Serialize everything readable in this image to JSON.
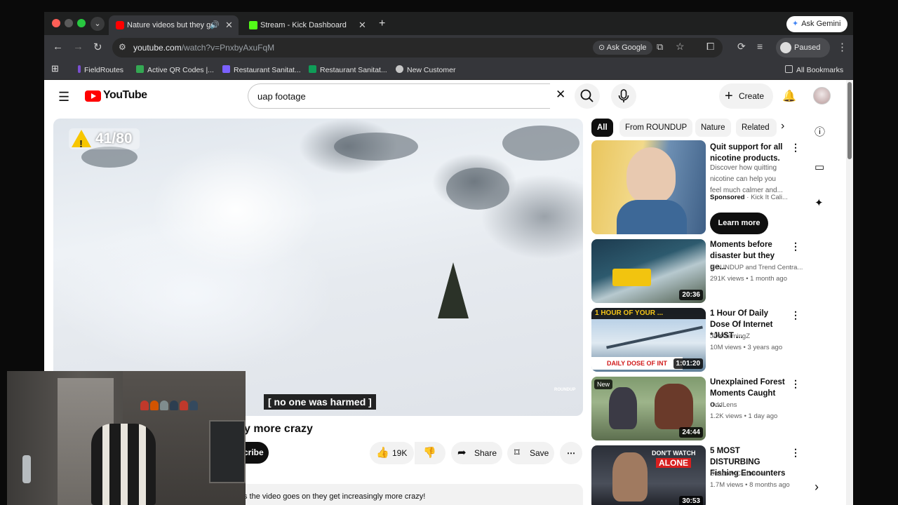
{
  "browser": {
    "tabs": [
      {
        "title": "Nature videos but they ge",
        "favicon_color": "#ff0000",
        "active": true
      },
      {
        "title": "Stream - Kick Dashboard",
        "favicon_color": "#53fc18",
        "active": false
      }
    ],
    "ask_gemini": "Ask Gemini",
    "url_host": "youtube.com",
    "url_path": "/watch?v=PnxbyAxuFqM",
    "ask_google": "Ask Google",
    "profile_status": "Paused",
    "bookmarks": [
      {
        "label": "FieldRoutes",
        "icon_color": "#7a4fd1"
      },
      {
        "label": "Active QR Codes |...",
        "icon_color": "#34a853"
      },
      {
        "label": "Restaurant Sanitat...",
        "icon_color": "#7b61ff"
      },
      {
        "label": "Restaurant Sanitat...",
        "icon_color": "#0f9d58"
      },
      {
        "label": "New Customer",
        "icon_color": "#c6c6c6"
      }
    ],
    "all_bookmarks": "All Bookmarks"
  },
  "youtube": {
    "logo_text": "YouTube",
    "search_query": "uap footage",
    "create_label": "Create",
    "player": {
      "counter": "41/80",
      "caption": "[ no one was harmed ]",
      "watermark": "ROUNDUP"
    },
    "video_title": "y more crazy",
    "subscribe_label": "cribe",
    "actions": {
      "likes": "19K",
      "share": "Share",
      "save": "Save"
    },
    "description": "s the video goes on they get increasingly more crazy!",
    "chips": [
      "All",
      "From ROUNDUP",
      "Nature",
      "Related"
    ],
    "ad": {
      "title": "Quit support for all nicotine products.",
      "description": "Discover how quitting nicotine can help you feel much calmer and...",
      "sponsored": "Sponsored",
      "advertiser": "Kick It Cali...",
      "cta": "Learn more"
    },
    "recommendations": [
      {
        "title": "Moments before disaster but they ge...",
        "channel": "ROUNDUP and Trend Centra...",
        "meta": "291K views • 1 month ago",
        "duration": "20:36",
        "is_new": false
      },
      {
        "title": "1 Hour Of Daily Dose Of Internet *JUST ...",
        "channel": "JDXGamingZ",
        "meta": "10M views • 3 years ago",
        "duration": "1:01:20",
        "is_new": false,
        "thumb_text_top": "1 HOUR OF YOUR ...",
        "thumb_text_bottom": "DAILY DOSE OF INT"
      },
      {
        "title": "Unexplained Forest Moments Caught o...",
        "channel": "OddLens",
        "meta": "1.2K views • 1 day ago",
        "duration": "24:44",
        "is_new": true,
        "new_label": "New"
      },
      {
        "title": "5 MOST DISTURBING Fishing Encounters",
        "channel": "Shadow Chronicles",
        "meta": "1.7M views • 8 months ago",
        "duration": "30:53",
        "is_new": false,
        "thumb_text_top": "DON'T WATCH",
        "thumb_text_bottom": "ALONE"
      }
    ]
  }
}
